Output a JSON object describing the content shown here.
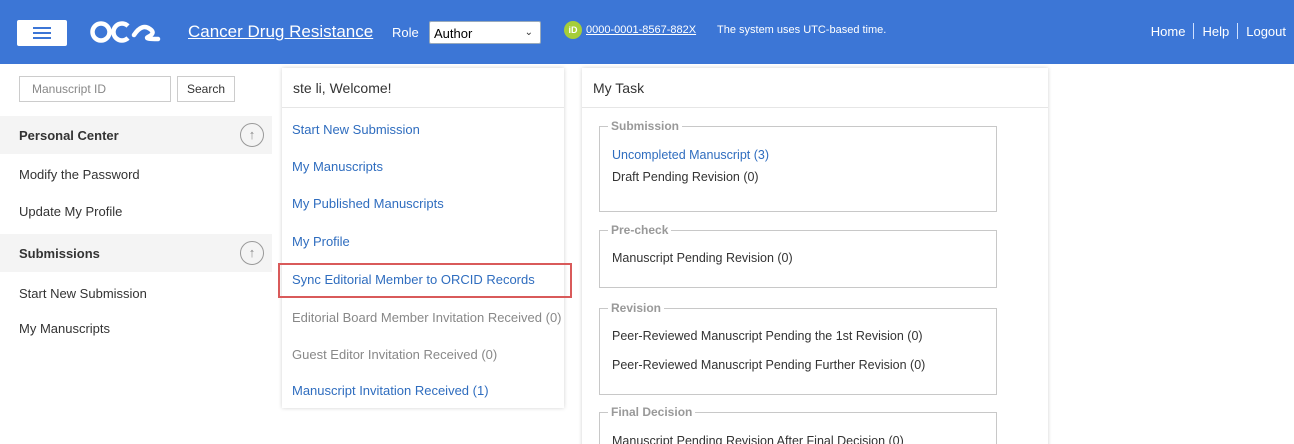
{
  "header": {
    "logo_text": "oae",
    "journal": "Cancer Drug Resistance",
    "role_label": "Role",
    "role_value": "Author",
    "orcid_id": "0000-0001-8567-882X",
    "time_note": "The system uses UTC-based time.",
    "nav": [
      "Home",
      "Help",
      "Logout"
    ]
  },
  "sidebar": {
    "search_placeholder": "Manuscript ID",
    "search_button": "Search",
    "sections": [
      {
        "title": "Personal Center",
        "items": [
          "Modify the Password",
          "Update My Profile"
        ]
      },
      {
        "title": "Submissions",
        "items": [
          "Start New Submission",
          "My Manuscripts"
        ]
      }
    ]
  },
  "welcome_panel": {
    "title": "ste li, Welcome!",
    "items": [
      "Start New Submission",
      "My Manuscripts",
      "My Published Manuscripts",
      "My Profile",
      "Sync Editorial Member to ORCID Records",
      "Editorial Board Member Invitation Received (0)",
      "Guest Editor Invitation Received (0)",
      "Manuscript Invitation Received (1)"
    ]
  },
  "task_panel": {
    "title": "My Task",
    "groups": [
      {
        "legend": "Submission",
        "items": [
          "Uncompleted Manuscript (3)",
          "Draft Pending Revision (0)"
        ]
      },
      {
        "legend": "Pre-check",
        "items": [
          "Manuscript Pending Revision (0)"
        ]
      },
      {
        "legend": "Revision",
        "items": [
          "Peer-Reviewed Manuscript Pending the 1st Revision (0)",
          "Peer-Reviewed Manuscript Pending Further Revision (0)"
        ]
      },
      {
        "legend": "Final Decision",
        "items": [
          "Manuscript Pending Revision After Final Decision (0)"
        ]
      }
    ]
  },
  "colors": {
    "topbar": "#3c76d6",
    "link": "#2f6dbf",
    "highlight": "#d95a5a",
    "orcid": "#a6ce39"
  }
}
